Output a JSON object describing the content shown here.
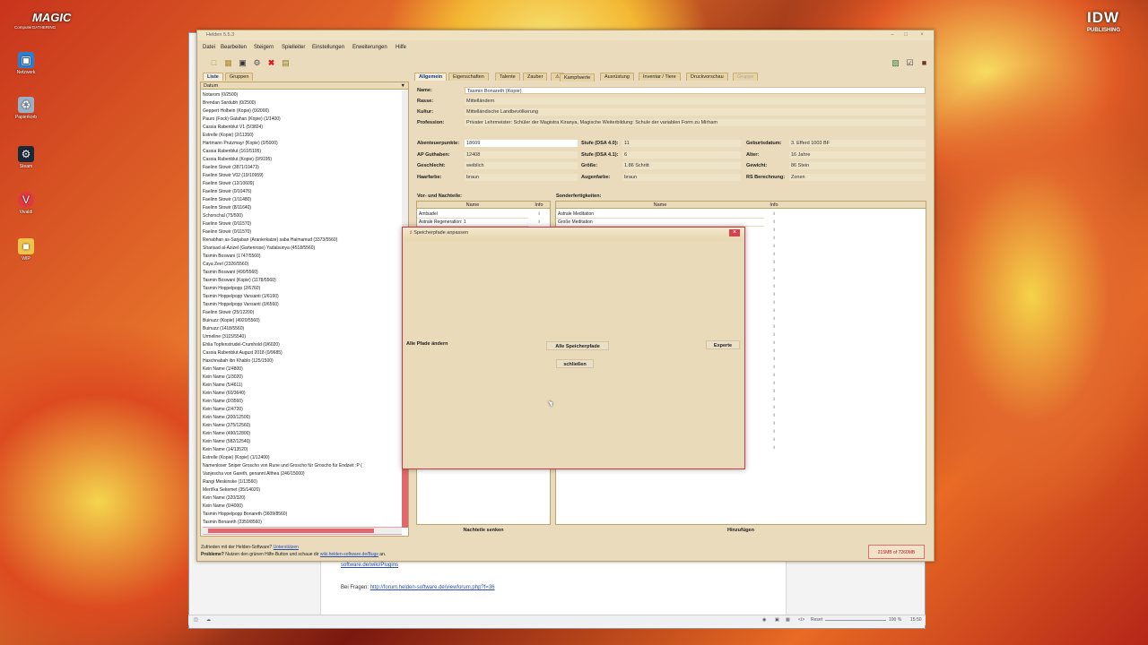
{
  "desktop": {
    "brand_left": "MAGIC",
    "brand_left_sub": "ComputerGATHERING",
    "brand_right": "IDW",
    "brand_right_sub": "PUBLISHING",
    "icons": [
      {
        "label": "Netzwerk",
        "icon": "network-icon"
      },
      {
        "label": "Papierkorb",
        "icon": "recycle-bin-icon"
      },
      {
        "label": "Steam",
        "icon": "steam-icon"
      },
      {
        "label": "Vivaldi",
        "icon": "vivaldi-icon"
      },
      {
        "label": "WIP",
        "icon": "folder-icon"
      }
    ]
  },
  "browser": {
    "link_fragment": "software.de/wiki/Plugins",
    "question_text": "Bei Fragen:",
    "forum_link": "http://forum.helden-software.de/viewforum.php?f=36",
    "status_reset": "Reset",
    "status_zoom": "100 %",
    "status_time": "15:50"
  },
  "app": {
    "title": "Helden 5.5.3",
    "menu": [
      "Datei",
      "Bearbeiten",
      "Steigern",
      "Spielleiter",
      "Einstellungen",
      "Erweiterungen",
      "Hilfe"
    ],
    "left_tabs": [
      "Liste",
      "Gruppen"
    ],
    "list_header": "Datum",
    "list_items": [
      "Notarom (0/2500)",
      "Brendan Sardubh (0/2500)",
      "Geppert Holbein (Kopie) (0/2000)",
      "Pauro (Fock) Galahan (Kopie) (1/1400)",
      "Cassia Rabenblut V1 (5/3824)",
      "Estrelle (Kopie) (2/11350)",
      "Hartmann Prutzmayr (Kopie) (0/5000)",
      "Cassia Rabenblut (161/5195)",
      "Cassia Rabenblut (Kopie) (0/9195)",
      "Faelinn Stowir (3871/10473)",
      "Faelinn Stowir V02 (19/10959)",
      "Faelinn Stowir (12/10609)",
      "Faelinn Stowir (0/10476)",
      "Faelinn Stowir (1/11480)",
      "Faelinn Stowir (8/11640)",
      "Schorschal (75/500)",
      "Faelinn Stowir (0/11570)",
      "Faelinn Stowir (0/11570)",
      "Renabhan as-Sarjaban (Aranierkatze) saba Haimamud (3373/5560)",
      "Sharisad al-Azizel (Gartenrose) Yadalsunya (4518/5560)",
      "Tasmin Boswani (1747/5560)",
      "Caya Zeel (2326/5560)",
      "Tasmin Boswani (490/5560)",
      "Tasmin Boswani (Kopie) (1178/5560)",
      "Tasmin Hoppelpopp (2/6760)",
      "Tasmin Hoppelpopp Vansanti (1/6160)",
      "Tasmin Hoppelpopp Vansanti (0/6560)",
      "Faelinn Stowir (25/12200)",
      "Buinuzz (Kopie) (4920/5560)",
      "Buinuzz (1418/5560)",
      "Urmeline (3115/5540)",
      "Ehlia Topfenstrudel-Crumhold (0/6020)",
      "Cassia Rabenblut August 2018 (0/9685)",
      "Haschnabah ibn Khablo (125/1500)",
      "Kein Name (1/4800)",
      "Kein Name (1/3020)",
      "Kein Name (5/4611)",
      "Kein Name (60/3640)",
      "Kein Name (0/3560)",
      "Kein Name (2/4720)",
      "Kein Name (300/12500)",
      "Kein Name (375/12560)",
      "Kein Name (490/12800)",
      "Kein Name (582/12540)",
      "Kein Name (14/13520)",
      "Estrelle (Kopie) (Kopie) (1/12400)",
      "Namenloser Sniper Groscho von Rune und Groscho für Groscho für Endzeit :P (",
      "Vanjescha von Gareth, genannt Althea (246/15000)",
      "Rangi Meskinske (1/13560)",
      "Merit'ka Sekemet (35/14020)",
      "Kein Name (320/320)",
      "Kein Name (0/4000)",
      "Tasmin Hoppelpopp Bonareth (3609/8560)",
      "Tasmin Bonareth (2359/8560)",
      "*Tasmin Bonareth (Kopie) (12408/18609)"
    ],
    "right_tabs": [
      "Allgemein",
      "Eigenschaften",
      "Talente",
      "Zauber",
      "Kampfwerte",
      "Ausrüstung",
      "Inventar / Tiere",
      "Druckvorschau",
      "Gruppe"
    ],
    "general": {
      "name_label": "Name:",
      "name_value": "Tasmin Bonareth (Kopie)",
      "rasse_label": "Rasse:",
      "rasse_value": "Mittelländern",
      "kultur_label": "Kultur:",
      "kultur_value": "Mittelländische Landbevölkerung",
      "profession_label": "Profession:",
      "profession_value": "Privater Lehrmeister: Schüler der Magistra Kiranya, Magische Weiterbildung: Schule der variablen Form zu Mirham"
    },
    "stats_left": [
      {
        "label": "Abenteuerpunkte:",
        "value": "18609"
      },
      {
        "label": "AP Guthaben:",
        "value": "12408"
      },
      {
        "label": "Geschlecht:",
        "value": "weiblich"
      },
      {
        "label": "Haarfarbe:",
        "value": "braun"
      }
    ],
    "stats_mid": [
      {
        "label": "Stufe (DSA 4.0):",
        "value": "11"
      },
      {
        "label": "Stufe (DSA 4.1):",
        "value": "6"
      },
      {
        "label": "Größe:",
        "value": "1.86 Schritt"
      },
      {
        "label": "Augenfarbe:",
        "value": "braun"
      }
    ],
    "stats_right": [
      {
        "label": "Geburtsdatum:",
        "value": "3. Efferd 1003 BF"
      },
      {
        "label": "Alter:",
        "value": "16 Jahre"
      },
      {
        "label": "Gewicht:",
        "value": "86 Stein"
      },
      {
        "label": "RS Berechnung:",
        "value": "Zonen"
      }
    ],
    "vor_nachteile": {
      "title": "Vor- und Nachteile:",
      "col_name": "Name",
      "col_info": "Info",
      "rows": [
        {
          "name": "Amtsadel",
          "info": "i"
        },
        {
          "name": "Astrale Regeneration: 1",
          "info": "i"
        }
      ],
      "button": "Nachteile senken"
    },
    "sonderfertigkeiten": {
      "title": "Sonderfertigkeiten:",
      "col_name": "Name",
      "col_info": "Info",
      "rows": [
        {
          "name": "Astrale Meditation",
          "info": "i"
        },
        {
          "name": "Große Meditation",
          "info": "i"
        }
      ],
      "info_marker": "i",
      "button": "Hinzufügen"
    },
    "status": {
      "line1_prefix": "Zufrieden mit der Helden-Software?",
      "line1_link": "Unterstützen",
      "line2_prefix": "Probleme?",
      "line2_text": "Nutzen den grünen Hilfe-Button und schaue dir",
      "line2_link": "wiki.helden-software.de/Bugs",
      "line2_suffix": "an.",
      "memory": "215MB of 7260MB"
    }
  },
  "dialog": {
    "title": "Speicherpfade anpassen",
    "label": "Alle Pfade ändern",
    "all_paths_button": "Alle Speicherpfade",
    "expert_button": "Experte",
    "close_button": "schließen"
  }
}
